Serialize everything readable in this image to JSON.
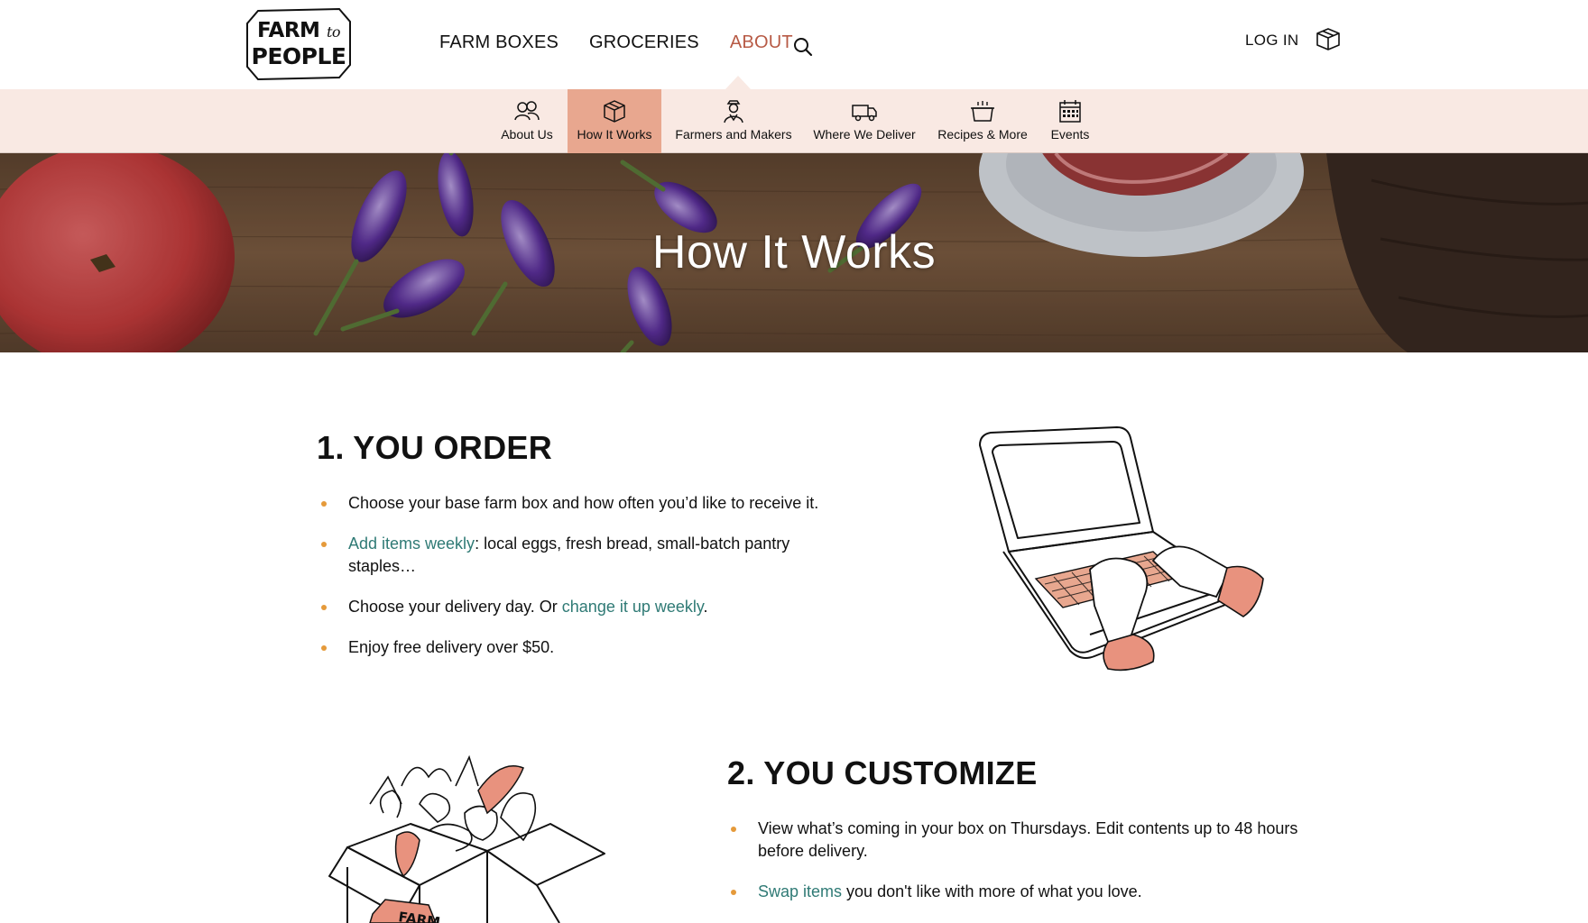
{
  "header": {
    "logo": {
      "line1": "FARM",
      "line1_small": "to",
      "line2": "PEOPLE"
    },
    "nav": [
      {
        "label": "FARM BOXES",
        "active": false
      },
      {
        "label": "GROCERIES",
        "active": false
      },
      {
        "label": "ABOUT",
        "active": true
      }
    ],
    "search_icon": "search-icon",
    "login_label": "LOG IN",
    "cart_icon": "box-icon"
  },
  "subnav": {
    "items": [
      {
        "label": "About Us",
        "icon": "people-icon",
        "active": false
      },
      {
        "label": "How It Works",
        "icon": "box-icon",
        "active": true
      },
      {
        "label": "Farmers and Makers",
        "icon": "farmer-icon",
        "active": false
      },
      {
        "label": "Where We Deliver",
        "icon": "truck-icon",
        "active": false
      },
      {
        "label": "Recipes & More",
        "icon": "pot-icon",
        "active": false
      },
      {
        "label": "Events",
        "icon": "calendar-icon",
        "active": false
      }
    ]
  },
  "hero": {
    "title": "How It Works"
  },
  "sections": [
    {
      "title": "1. YOU ORDER",
      "items": [
        {
          "text": "Choose your base farm box and how often you’d like to receive it."
        },
        {
          "link": "Add items weekly",
          "text": ": local eggs, fresh bread, small-batch pantry staples…"
        },
        {
          "text_before": "Choose your delivery day. Or ",
          "link": "change it up weekly",
          "text_after": "."
        },
        {
          "text": "Enjoy free delivery over $50."
        }
      ],
      "illustration": "laptop-illustration"
    },
    {
      "title": "2. YOU CUSTOMIZE",
      "items": [
        {
          "text": "View what’s coming in your box on Thursdays. Edit contents up to 48 hours before delivery."
        },
        {
          "link": "Swap items",
          "text": " you don't like with more of what you love."
        }
      ],
      "illustration": "farm-box-illustration",
      "box_label": "FARM"
    }
  ],
  "colors": {
    "accent": "#b75a45",
    "subnav_bg": "#f9e9e3",
    "subnav_active": "#e8a78f",
    "link": "#2f7a75",
    "bullet": "#e59a3a"
  }
}
